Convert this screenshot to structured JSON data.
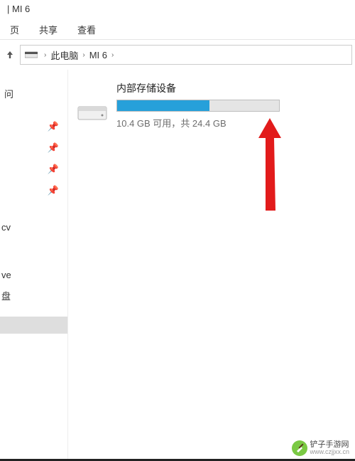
{
  "window": {
    "title": "|  MI 6"
  },
  "ribbon": {
    "tabs": [
      "页",
      "共享",
      "查看"
    ]
  },
  "breadcrumb": {
    "items": [
      "此电脑",
      "MI 6"
    ]
  },
  "sidebar": {
    "quick_label": "问",
    "items": [
      "cv",
      "ve",
      "盘"
    ]
  },
  "device": {
    "name": "内部存储设备",
    "free_text": "10.4 GB 可用，",
    "total_text": "共 24.4 GB",
    "free_gb": 10.4,
    "total_gb": 24.4,
    "used_percent": 57
  },
  "watermark": {
    "line1": "铲子手游网",
    "url": "www.czjjxx.cn"
  }
}
